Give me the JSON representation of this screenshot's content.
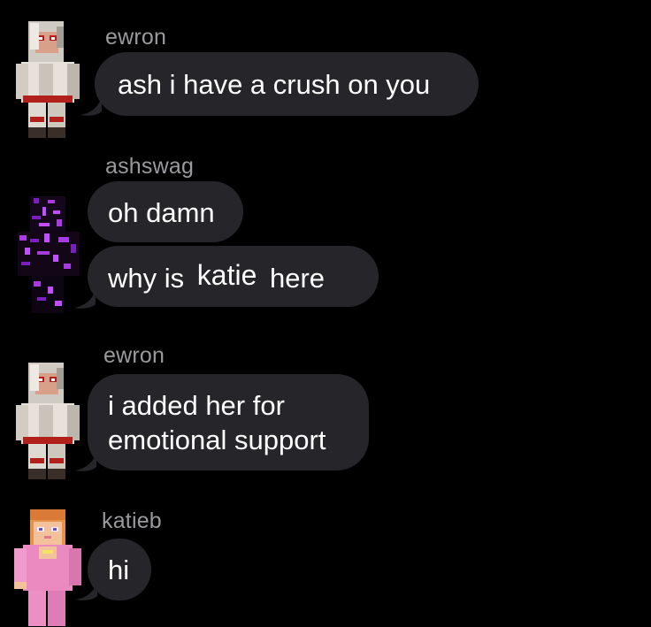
{
  "messages": [
    {
      "sender": "ewron",
      "avatar": "red-white-hooded-skin-avatar",
      "bubbles": [
        "ash i have a crush on you"
      ]
    },
    {
      "sender": "ashswag",
      "avatar": "purple-black-glitch-skin-avatar",
      "bubbles": [
        "oh damn"
      ],
      "mention_bubble": {
        "before": "why is",
        "mention": "katie",
        "after": "here"
      }
    },
    {
      "sender": "ewron",
      "avatar": "red-white-hooded-skin-avatar",
      "bubbles": [
        "i added her for",
        "emotional support"
      ]
    },
    {
      "sender": "katieb",
      "avatar": "pink-outfit-orange-hair-skin-avatar",
      "bubbles": [
        "hi"
      ]
    }
  ],
  "colors": {
    "background": "#000000",
    "bubble": "#26262a",
    "sender_text": "#9a9a9e",
    "message_text": "#ffffff"
  }
}
